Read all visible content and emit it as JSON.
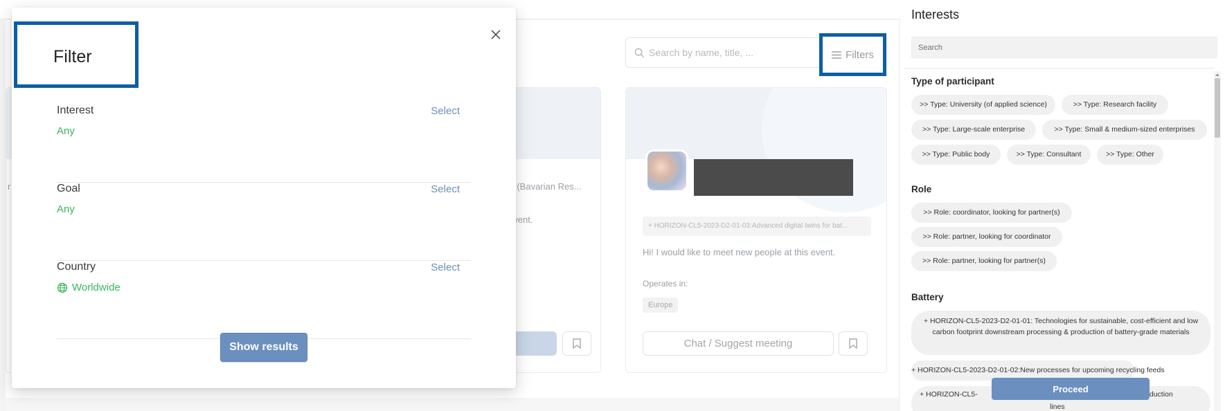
{
  "background": {
    "search": {
      "placeholder": "Search by name, title, ..."
    },
    "filters_label": "Filters",
    "left_card": {
      "snippet1": "r",
      "snippet2": "nz (Bavarian Res...",
      "snippet3": "event."
    },
    "right_card": {
      "topic": "+ HORIZON-CL5-2023-D2-01-03:Advanced digital twins for bat...",
      "message": "Hi! I would like to meet new people at this event.",
      "operates_label": "Operates in:",
      "operates_value": "Europe",
      "chat_button": "Chat / Suggest meeting"
    }
  },
  "modal": {
    "title": "Filter",
    "close_label": "X",
    "rows": [
      {
        "label": "Interest",
        "value": "Any",
        "action": "Select"
      },
      {
        "label": "Goal",
        "value": "Any",
        "action": "Select"
      },
      {
        "label": "Country",
        "value": "Worldwide",
        "action": "Select"
      }
    ],
    "show_results": "Show results"
  },
  "panel": {
    "title": "Interests",
    "search_placeholder": "Search",
    "sections": {
      "type": {
        "title": "Type of participant",
        "chips": [
          ">> Type: University (of applied science)",
          ">> Type: Research facility",
          ">> Type: Large-scale enterprise",
          ">> Type: Small & medium-sized enterprises",
          ">> Type: Public body",
          ">> Type: Consultant",
          ">> Type: Other"
        ]
      },
      "role": {
        "title": "Role",
        "chips": [
          ">> Role: coordinator, looking for partner(s)",
          ">> Role: partner, looking for coordinator",
          ">> Role: partner, looking for partner(s)"
        ]
      },
      "battery": {
        "title": "Battery",
        "chips": [
          "+ HORIZON-CL5-2023-D2-01-01: Technologies for sustainable, cost-efficient and low carbon footprint downstream processing & production of battery-grade materials",
          "+ HORIZON-CL5-2023-D2-01-02:New processes for upcoming recycling feeds",
          "+ HORIZON-CL5-",
          "cell production",
          "lines"
        ]
      }
    },
    "proceed": "Proceed"
  },
  "colors": {
    "highlight_border": "#0d5ea4",
    "accent_button": "#6b8fbf",
    "green_value": "#3cb35c",
    "select_link": "#6b8eb8"
  },
  "icons": [
    "search-icon",
    "hamburger-icon",
    "close-icon",
    "globe-icon",
    "bookmark-icon"
  ]
}
